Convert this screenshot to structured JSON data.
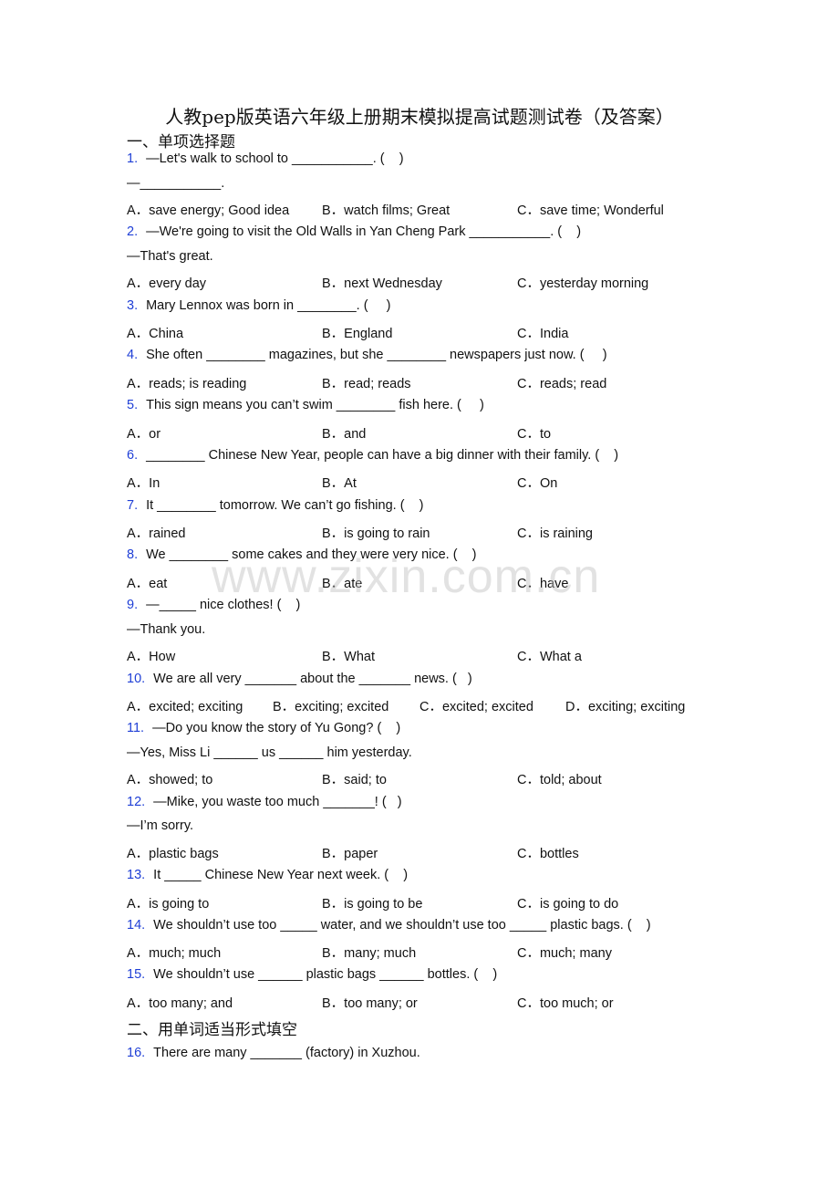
{
  "title": "人教pep版英语六年级上册期末模拟提高试题测试卷（及答案）",
  "sections": [
    {
      "label": "一、单项选择题"
    },
    {
      "label": "二、用单词适当形式填空"
    }
  ],
  "watermark": "www.zixin.com.cn",
  "questions": [
    {
      "num": "1.",
      "text": "—Let's walk to school to ___________. (    )",
      "extra": "—___________.",
      "options": [
        "A．save energy; Good idea",
        "B．watch films; Great",
        "C．save time; Wonderful"
      ]
    },
    {
      "num": "2.",
      "text": "—We're going to visit the Old Walls in Yan Cheng Park ___________. (    )",
      "extra": "—That's great.",
      "options": [
        "A．every day",
        "B．next Wednesday",
        "C．yesterday morning"
      ]
    },
    {
      "num": "3.",
      "text": "Mary Lennox was born in ________. (     )",
      "options": [
        "A．China",
        "B．England",
        "C．India"
      ]
    },
    {
      "num": "4.",
      "text": "She often ________ magazines, but she ________ newspapers just now. (     )",
      "options": [
        "A．reads; is reading",
        "B．read; reads",
        "C．reads; read"
      ]
    },
    {
      "num": "5.",
      "text": "This sign means you can’t swim ________ fish here. (     )",
      "options": [
        "A．or",
        "B．and",
        "C．to"
      ]
    },
    {
      "num": "6.",
      "text": "________ Chinese New Year, people can have a big dinner with their family. (    )",
      "options": [
        "A．In",
        "B．At",
        "C．On"
      ]
    },
    {
      "num": "7.",
      "text": "It ________ tomorrow. We can’t go fishing. (    )",
      "options": [
        "A．rained",
        "B．is going to rain",
        "C．is raining"
      ]
    },
    {
      "num": "8.",
      "text": "We ________ some cakes and they were very nice. (    )",
      "options": [
        "A．eat",
        "B．ate",
        "C．have"
      ]
    },
    {
      "num": "9.",
      "text": "—_____ nice clothes! (    )",
      "extra": "—Thank you.",
      "options": [
        "A．How",
        "B．What",
        "C．What a"
      ]
    },
    {
      "num": "10.",
      "text": "We are all very _______ about the _______ news. (   )",
      "options": [
        "A．excited; exciting",
        "B．exciting; excited",
        "C．excited; excited",
        "D．exciting; exciting"
      ]
    },
    {
      "num": "11.",
      "text": "—Do you know the story of Yu Gong? (    )",
      "extra": "—Yes, Miss Li ______ us ______ him yesterday.",
      "options": [
        "A．showed; to",
        "B．said; to",
        "C．told; about"
      ]
    },
    {
      "num": "12.",
      "text": "—Mike, you waste too much _______! (   )",
      "extra": "—I’m sorry.",
      "options": [
        "A．plastic bags",
        "B．paper",
        "C．bottles"
      ]
    },
    {
      "num": "13.",
      "text": "It _____ Chinese New Year next week. (    )",
      "options": [
        "A．is going to",
        "B．is going to be",
        "C．is going to do"
      ]
    },
    {
      "num": "14.",
      "text": "We shouldn’t use too _____ water, and we shouldn’t use too _____ plastic bags. (    )",
      "options": [
        "A．much; much",
        "B．many; much",
        "C．much; many"
      ]
    },
    {
      "num": "15.",
      "text": "We shouldn’t use ______ plastic bags ______ bottles. (    )",
      "options": [
        "A．too many; and",
        "B．too many; or",
        "C．too much; or"
      ]
    },
    {
      "num": "16.",
      "text": "There are many _______ (factory) in Xuzhou."
    }
  ]
}
